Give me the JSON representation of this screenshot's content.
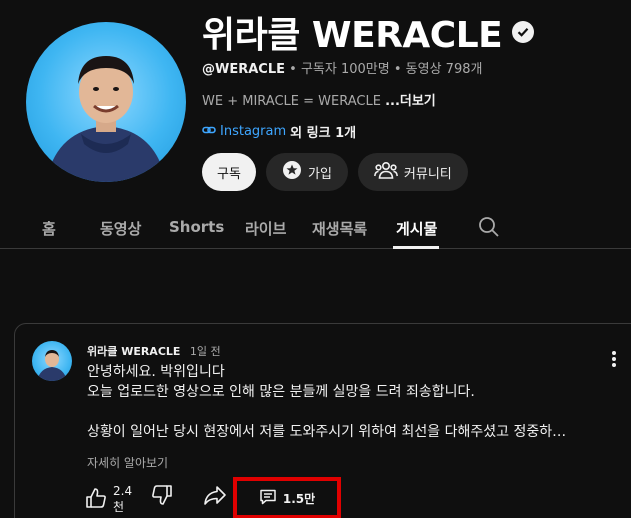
{
  "channel": {
    "name": "위라클 WERACLE",
    "handle": "@WERACLE",
    "subscribers": "구독자 100만명",
    "videos": "동영상 798개",
    "dot": "•",
    "description": "WE + MIRACLE = WERACLE",
    "more_label": "...더보기",
    "link_label": "Instagram",
    "other_links": "외 링크 1개"
  },
  "buttons": {
    "subscribe": "구독",
    "join": "가입",
    "community": "커뮤니티"
  },
  "tabs": [
    "홈",
    "동영상",
    "Shorts",
    "라이브",
    "재생목록",
    "게시물"
  ],
  "active_tab": "게시물",
  "post": {
    "author": "위라클 WERACLE",
    "time": "1일 전",
    "lines": [
      "안녕하세요. 박위입니다",
      "오늘 업로드한 영상으로 인해 많은 분들께 실망을 드려 죄송합니다.",
      "",
      "상황이 일어난 당시 현장에서 저를 도와주시기 위하여 최선을 다해주셨고 정중하…"
    ],
    "read_more": "자세히 알아보기",
    "likes": "2.4천",
    "comments": "1.5만"
  },
  "colors": {
    "background": "#0f0f0f",
    "link": "#3ea6ff",
    "highlight_box": "#e00000"
  },
  "icons": [
    "verified-icon",
    "link-icon",
    "star-icon",
    "community-icon",
    "search-icon",
    "kebab-icon",
    "like-icon",
    "dislike-icon",
    "share-icon",
    "comment-icon"
  ]
}
